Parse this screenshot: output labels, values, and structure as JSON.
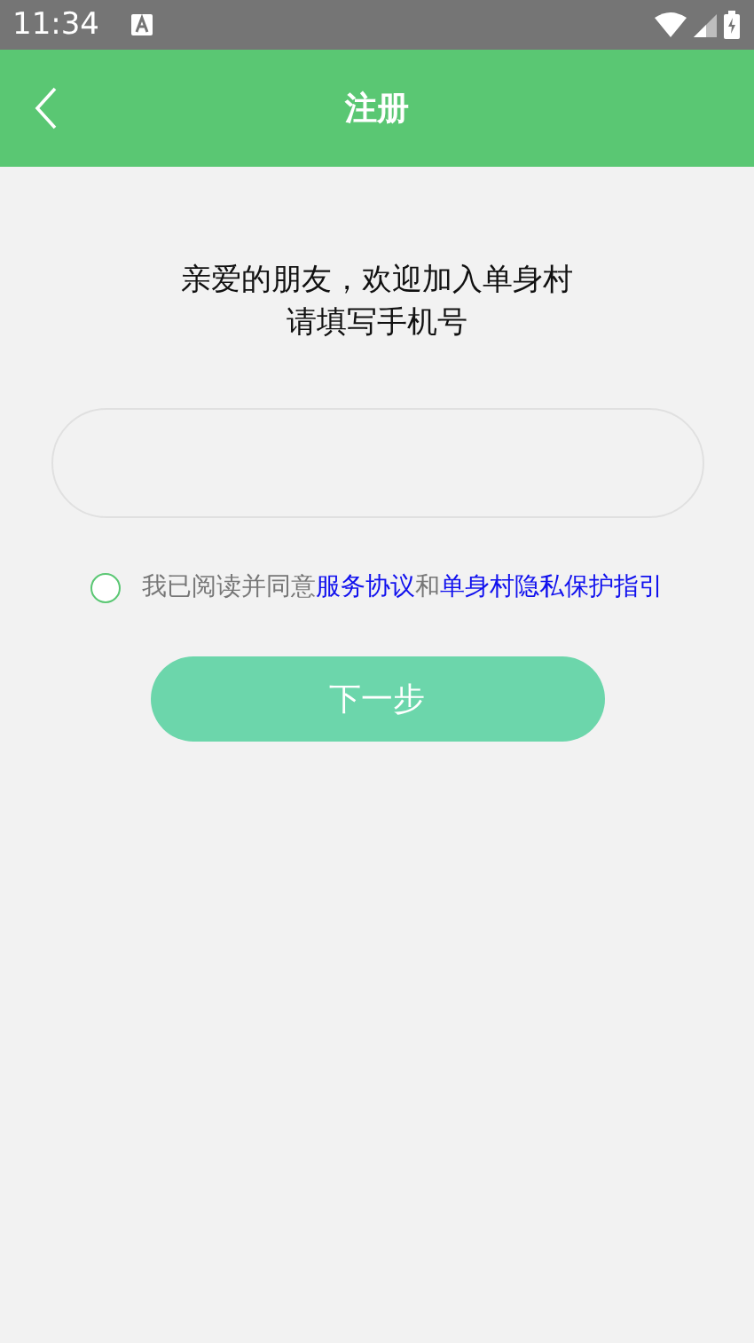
{
  "status_bar": {
    "time": "11:34"
  },
  "header": {
    "title": "注册"
  },
  "greeting": [
    "亲爱的朋友，欢迎加入单身村",
    "请填写手机号"
  ],
  "agreement": {
    "checked": false,
    "segments": [
      {
        "kind": "plain",
        "text": "我已阅读并同意"
      },
      {
        "kind": "link",
        "text": "服务协议"
      },
      {
        "kind": "plain",
        "text": "和"
      },
      {
        "kind": "link",
        "text": "单身村隐私保护指引"
      }
    ]
  },
  "next_button": {
    "label": "下一步",
    "disabled": true
  }
}
